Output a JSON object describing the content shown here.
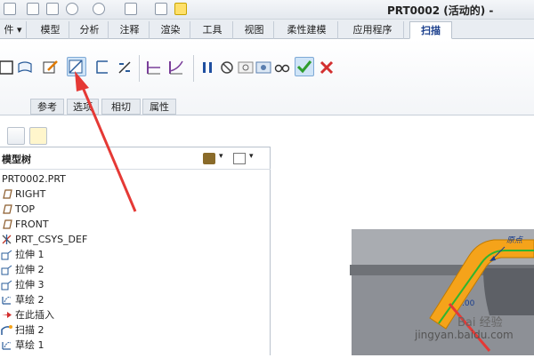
{
  "window": {
    "title": "PRT0002 (活动的) -"
  },
  "quick_access": {
    "items": [
      "new-icon",
      "open-icon",
      "save-icon",
      "undo-icon",
      "redo-icon",
      "regenerate-icon",
      "windows-icon"
    ]
  },
  "tabs": [
    {
      "label": "件 ▾"
    },
    {
      "label": "模型"
    },
    {
      "label": "分析"
    },
    {
      "label": "注释"
    },
    {
      "label": "渲染"
    },
    {
      "label": "工具"
    },
    {
      "label": "视图"
    },
    {
      "label": "柔性建模"
    },
    {
      "label": "应用程序"
    },
    {
      "label": "扫描"
    }
  ],
  "ribbon": {
    "group_tabs": [
      "参考",
      "选项",
      "相切",
      "属性"
    ],
    "buttons": [
      "solid-sweep-icon",
      "surface-sweep-icon",
      "sketch-icon",
      "remove-material-icon",
      "thicken-icon",
      "constant-section-icon",
      "variable-section-icon",
      "pause-icon",
      "no-preview-icon",
      "attached-preview-icon",
      "feature-preview-icon",
      "verify-icon",
      "ok-icon",
      "cancel-icon"
    ]
  },
  "tree": {
    "header": "模型树",
    "items": [
      {
        "label": "PRT0002.PRT",
        "icon": "part-icon"
      },
      {
        "label": "RIGHT",
        "icon": "datum-plane-icon"
      },
      {
        "label": "TOP",
        "icon": "datum-plane-icon"
      },
      {
        "label": "FRONT",
        "icon": "datum-plane-icon"
      },
      {
        "label": "PRT_CSYS_DEF",
        "icon": "csys-icon"
      },
      {
        "label": "拉伸 1",
        "icon": "extrude-icon"
      },
      {
        "label": "拉伸 2",
        "icon": "extrude-icon"
      },
      {
        "label": "拉伸 3",
        "icon": "extrude-icon"
      },
      {
        "label": "草绘 2",
        "icon": "sketch-icon"
      },
      {
        "label": "在此插入",
        "icon": "insert-here-icon"
      },
      {
        "label": "扫描 2",
        "icon": "sweep-icon"
      },
      {
        "label": "草绘 1",
        "icon": "sketch-icon"
      }
    ]
  },
  "viewport": {
    "annotation_origin": "原点",
    "dimension_value": ".00"
  },
  "watermark": {
    "text": "jingyan.baidu.com",
    "brand": "Bai 经验"
  },
  "colors": {
    "accent": "#1a3e8c",
    "sweep": "#f5a31a",
    "arrow": "#e53935",
    "ok": "#2e9d2e",
    "cancel": "#d32f2f"
  }
}
